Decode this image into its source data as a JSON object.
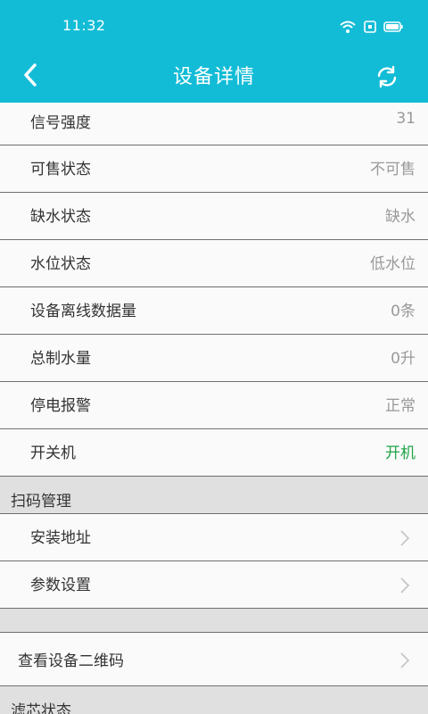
{
  "status_bar": {
    "time": "11:32",
    "icons": [
      "wifi-icon",
      "sim-icon",
      "battery-icon"
    ]
  },
  "header": {
    "title": "设备详情",
    "back_icon": "back-arrow-icon",
    "refresh_icon": "refresh-icon"
  },
  "rows": [
    {
      "label": "信号强度",
      "value": "31"
    },
    {
      "label": "可售状态",
      "value": "不可售"
    },
    {
      "label": "缺水状态",
      "value": "缺水"
    },
    {
      "label": "水位状态",
      "value": "低水位"
    },
    {
      "label": "设备离线数据量",
      "value": "0条"
    },
    {
      "label": "总制水量",
      "value": "0升"
    },
    {
      "label": "停电报警",
      "value": "正常"
    },
    {
      "label": "开关机",
      "value": "开机",
      "color": "#22a54a"
    }
  ],
  "scan_section": {
    "title": "扫码管理",
    "items": [
      {
        "label": "安装地址"
      },
      {
        "label": "参数设置"
      }
    ]
  },
  "qr_item": {
    "label": "查看设备二维码"
  },
  "filter_section": {
    "title": "滤芯状态"
  },
  "colors": {
    "header_bg": "#12bcd6",
    "section_bg": "#e0e0e0",
    "row_bg": "#fafafa",
    "on_green": "#22a54a"
  }
}
